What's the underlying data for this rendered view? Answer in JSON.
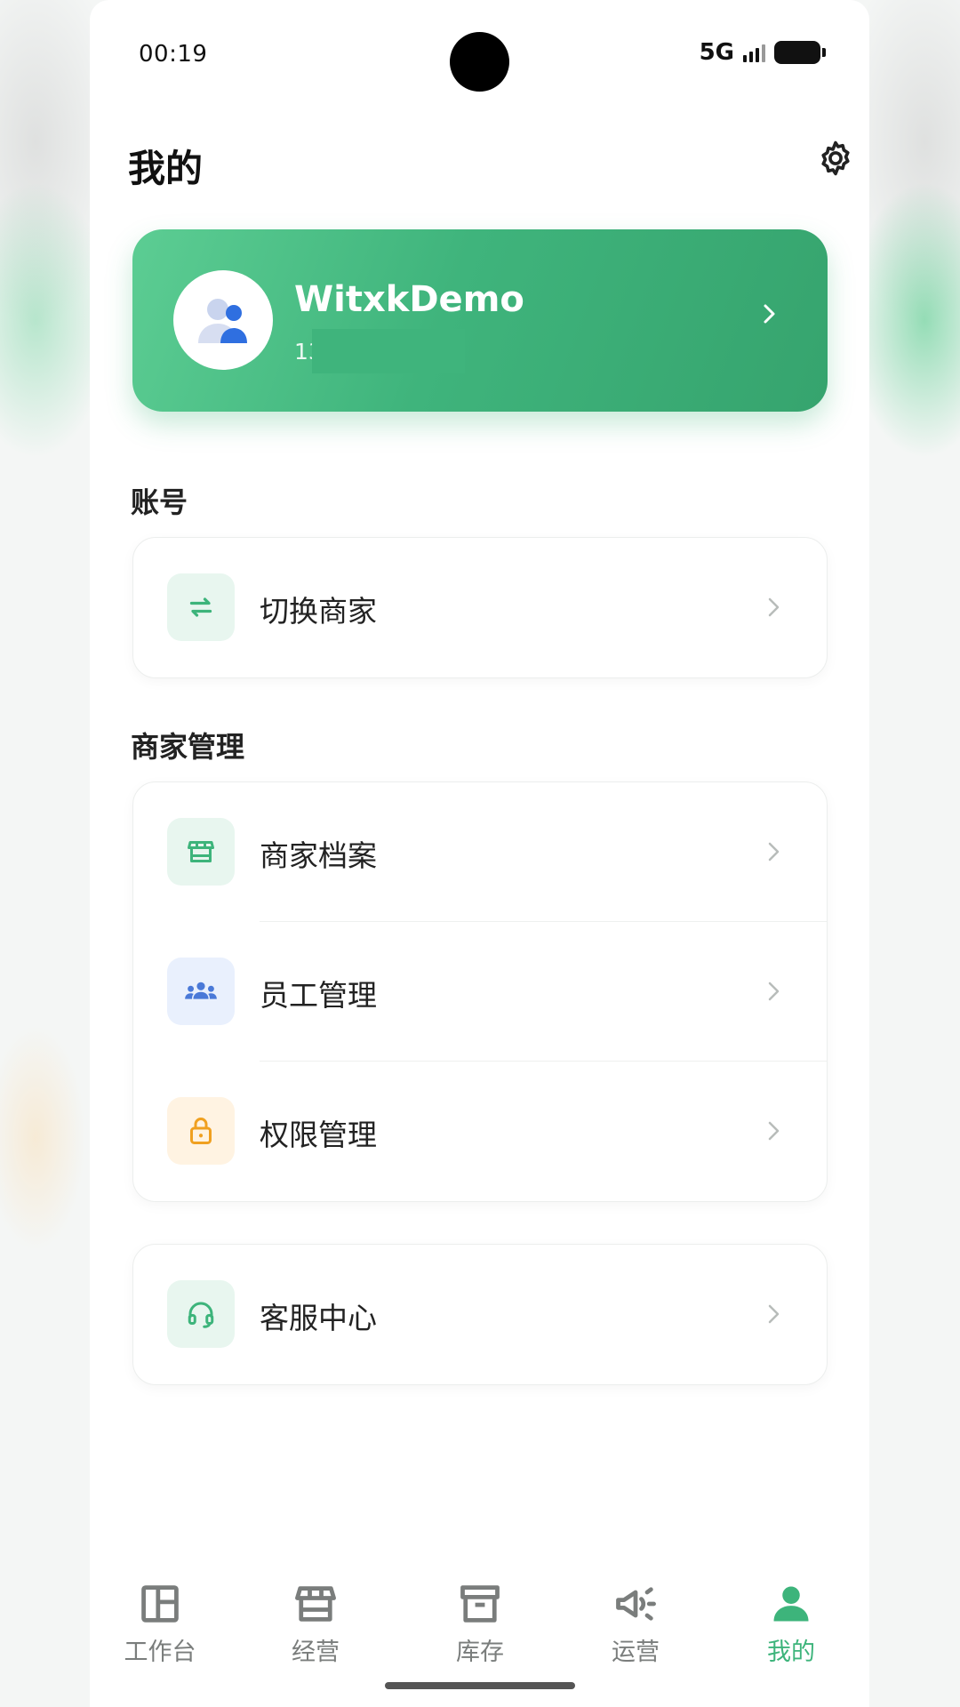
{
  "status_bar": {
    "time": "00:19",
    "network": "5G"
  },
  "header": {
    "title": "我的"
  },
  "profile": {
    "name": "WitxkDemo",
    "subtitle": "13 的商户"
  },
  "sections": [
    {
      "title": "账号",
      "items": [
        {
          "label": "切换商家",
          "icon": "swap-arrows-icon"
        }
      ]
    },
    {
      "title": "商家管理",
      "items": [
        {
          "label": "商家档案",
          "icon": "store-icon"
        },
        {
          "label": "员工管理",
          "icon": "team-icon"
        },
        {
          "label": "权限管理",
          "icon": "lock-icon"
        }
      ]
    },
    {
      "title": "",
      "items": [
        {
          "label": "客服中心",
          "icon": "headset-icon"
        }
      ]
    }
  ],
  "tabbar": {
    "tabs": [
      {
        "label": "工作台",
        "icon": "dashboard-icon"
      },
      {
        "label": "经营",
        "icon": "store-icon"
      },
      {
        "label": "库存",
        "icon": "archive-box-icon"
      },
      {
        "label": "运营",
        "icon": "megaphone-icon"
      },
      {
        "label": "我的",
        "icon": "user-icon"
      }
    ],
    "active": "我的"
  },
  "colors": {
    "brand_green": "#3db47b",
    "card_gradient_start": "#5ccd93",
    "card_gradient_end": "#36a46e",
    "blue_icon": "#4a79d8",
    "orange_icon": "#f0a020"
  }
}
